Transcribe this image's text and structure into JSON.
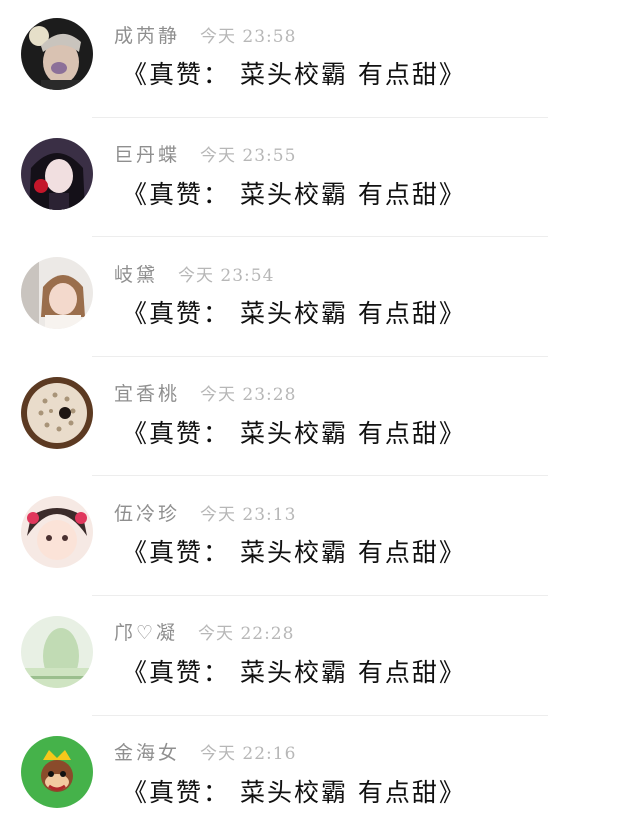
{
  "comments": [
    {
      "name": "成芮静",
      "time": "今天 23:58",
      "message": "《真赞： 菜头校霸 有点甜》",
      "avatar_icon": "avatar-icon"
    },
    {
      "name": "巨丹蝶",
      "time": "今天 23:55",
      "message": "《真赞： 菜头校霸 有点甜》",
      "avatar_icon": "avatar-icon"
    },
    {
      "name": "岐黛",
      "time": "今天 23:54",
      "message": "《真赞： 菜头校霸 有点甜》",
      "avatar_icon": "avatar-icon"
    },
    {
      "name": "宜香桃",
      "time": "今天 23:28",
      "message": "《真赞： 菜头校霸 有点甜》",
      "avatar_icon": "avatar-icon"
    },
    {
      "name": "伍冷珍",
      "time": "今天 23:13",
      "message": "《真赞： 菜头校霸 有点甜》",
      "avatar_icon": "avatar-icon"
    },
    {
      "name": "邝♡凝",
      "time": "今天 22:28",
      "message": "《真赞： 菜头校霸 有点甜》",
      "avatar_icon": "avatar-icon"
    },
    {
      "name": "金海女",
      "time": "今天 22:16",
      "message": "《真赞： 菜头校霸 有点甜》",
      "avatar_icon": "avatar-icon"
    }
  ]
}
